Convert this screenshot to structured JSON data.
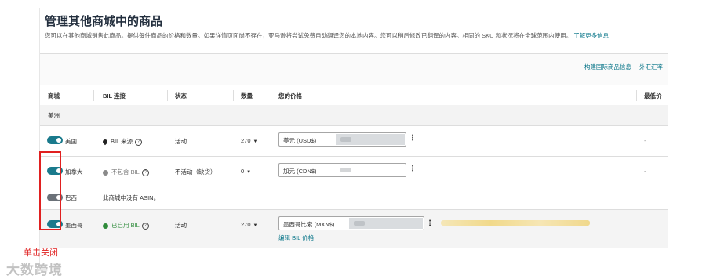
{
  "header": {
    "title": "管理其他商城中的商品",
    "description": "您可以在其他商城销售此商品。提供每件商品的价格和数量。如果详情页面尚不存在，亚马逊将尝试免费自动翻译您的本地内容。您可以稍后修改已翻译的内容。相同的 SKU 和状况将在全球范围内使用。",
    "learn_more": "了解更多信息"
  },
  "top_links": {
    "build_listing": "构建国际商品信息",
    "exchange_rate": "外汇汇率"
  },
  "columns": {
    "marketplace": "商城",
    "bil_link": "BIL 连接",
    "status": "状态",
    "quantity": "数量",
    "your_price": "您的价格",
    "lowest_price": "最低价"
  },
  "region": "美洲",
  "rows": [
    {
      "marketplace": "美国",
      "toggle_on": true,
      "bil": "BIL 来源",
      "status": "活动",
      "quantity": "270",
      "currency": "美元 (USD$)",
      "lowest": "-"
    },
    {
      "marketplace": "加拿大",
      "toggle_on": true,
      "bil": "不包含 BIL",
      "status": "不活动（缺货）",
      "quantity": "0",
      "currency": "加元 (CDN$)",
      "lowest": "-"
    },
    {
      "marketplace": "巴西",
      "toggle_on": false,
      "message": "此商城中没有 ASIN。"
    },
    {
      "marketplace": "墨西哥",
      "toggle_on": true,
      "bil": "已启用 BIL",
      "status": "活动",
      "quantity": "270",
      "currency": "墨西哥比索 (MXN$)",
      "edit_link": "编辑 BIL 价格"
    }
  ],
  "annotation": "单击关闭",
  "watermark": "大数跨境",
  "colors": {
    "toggle_on": "#1a7a8c",
    "toggle_off": "#6b7178",
    "link": "#007185",
    "annotation": "#e02020",
    "bil_enabled": "#2e8b3a"
  },
  "icons": {
    "bil_source": "map-pin-icon",
    "bil_excluded": "gray-circle-icon",
    "bil_enabled": "green-check-icon",
    "help": "question-circle-icon",
    "more": "kebab-icon"
  }
}
